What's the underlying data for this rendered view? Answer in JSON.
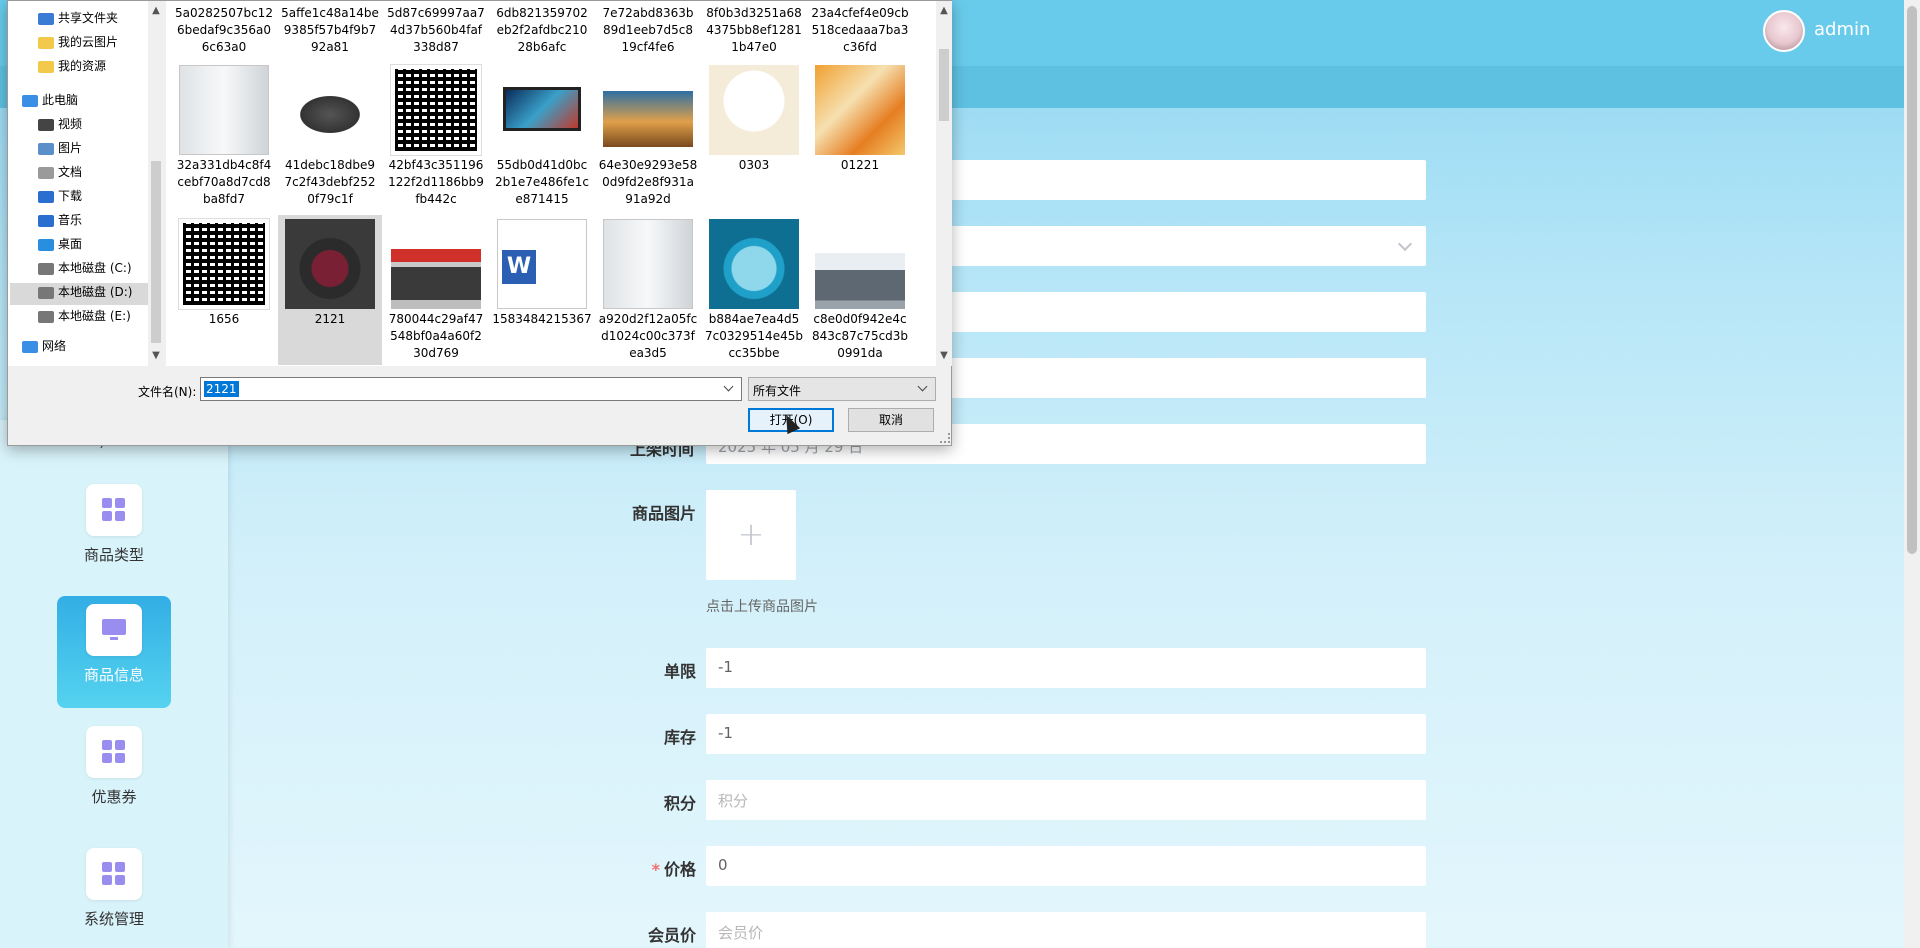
{
  "header": {
    "username": "admin"
  },
  "sidebar": {
    "partial_label": "户",
    "items": [
      {
        "label": "商品类型",
        "active": false,
        "icon": "grid-icon"
      },
      {
        "label": "商品信息",
        "active": true,
        "icon": "monitor-icon"
      },
      {
        "label": "优惠券",
        "active": false,
        "icon": "grid-icon"
      },
      {
        "label": "系统管理",
        "active": false,
        "icon": "grid-icon"
      }
    ]
  },
  "form": {
    "time_label_partial": "上架时间",
    "date_partial": "2025 年 05 月 29 日",
    "image_label": "商品图片",
    "image_hint": "点击上传商品图片",
    "fields": [
      {
        "label": "单限",
        "value": "-1",
        "placeholder": "",
        "required": false
      },
      {
        "label": "库存",
        "value": "-1",
        "placeholder": "",
        "required": false
      },
      {
        "label": "积分",
        "value": "",
        "placeholder": "积分",
        "required": false
      },
      {
        "label": "价格",
        "value": "0",
        "placeholder": "",
        "required": true
      },
      {
        "label": "会员价",
        "value": "",
        "placeholder": "会员价",
        "required": false
      }
    ]
  },
  "dialog": {
    "tree": [
      {
        "label": "共享文件夹",
        "icon": "share-folder-icon"
      },
      {
        "label": "我的云图片",
        "icon": "folder-icon"
      },
      {
        "label": "我的资源",
        "icon": "folder-icon"
      },
      {
        "label": "此电脑",
        "icon": "computer-icon"
      },
      {
        "label": "视频",
        "icon": "video-icon"
      },
      {
        "label": "图片",
        "icon": "picture-icon"
      },
      {
        "label": "文档",
        "icon": "document-icon"
      },
      {
        "label": "下载",
        "icon": "download-icon"
      },
      {
        "label": "音乐",
        "icon": "music-icon"
      },
      {
        "label": "桌面",
        "icon": "desktop-icon"
      },
      {
        "label": "本地磁盘 (C:)",
        "icon": "drive-icon"
      },
      {
        "label": "本地磁盘 (D:)",
        "icon": "drive-icon",
        "selected": true
      },
      {
        "label": "本地磁盘 (E:)",
        "icon": "drive-icon"
      },
      {
        "label": "网络",
        "icon": "network-icon"
      }
    ],
    "top_row_names": [
      "5a0282507bc12\n6bedaf9c356a0\n6c63a0",
      "5affe1c48a14be\n9385f57b4f9b7\n92a81",
      "5d87c69997aa7\n4d37b560b4faf\n338d87",
      "6db821359702\neb2f2afdbc210\n28b6afc",
      "7e72abd8363b\n89d1eeb7d5c8\n19cf4fe6",
      "8f0b3d3251a68\n4375bb8ef1281\n1b47e0",
      "23a4cfef4e09cb\n518cedaaa7ba3\nc36fd"
    ],
    "files": [
      {
        "name": "32a331db4c8f4\ncebf70a8d7cd8\nba8fd7",
        "thumb": "fridge"
      },
      {
        "name": "41debc18dbe9\n7c2f43debf252\n0f79c1f",
        "thumb": "pan"
      },
      {
        "name": "42bf43c351196\n122f2d1186bb9\nfb442c",
        "thumb": "qr"
      },
      {
        "name": "55db0d41d0bc\n2b1e7e486fe1c\ne871415",
        "thumb": "tv"
      },
      {
        "name": "64e30e9293e58\n0d9fd2e8f931a\n91a92d",
        "thumb": "landscape"
      },
      {
        "name": "0303",
        "thumb": "robot"
      },
      {
        "name": "01221",
        "thumb": "poster"
      },
      {
        "name": "1656",
        "thumb": "qr"
      },
      {
        "name": "2121",
        "thumb": "washer",
        "selected": true
      },
      {
        "name": "780044c29af47\n548bf0a4a60f2\n30d769",
        "thumb": "oven"
      },
      {
        "name": "1583484215367",
        "thumb": "word"
      },
      {
        "name": "a920d2f12a05fc\nd1024c00c373f\nea3d5",
        "thumb": "fridge2"
      },
      {
        "name": "b884ae7ea4d5\n7c0329514e45b\ncc35bbe",
        "thumb": "kettle"
      },
      {
        "name": "c8e0d0f942e4c\n843c87c75cd3b\n0991da",
        "thumb": "building"
      }
    ],
    "filename_label": "文件名(N):",
    "filename_value": "2121",
    "filetype_value": "所有文件",
    "open_label": "打开(O)",
    "cancel_label": "取消"
  }
}
